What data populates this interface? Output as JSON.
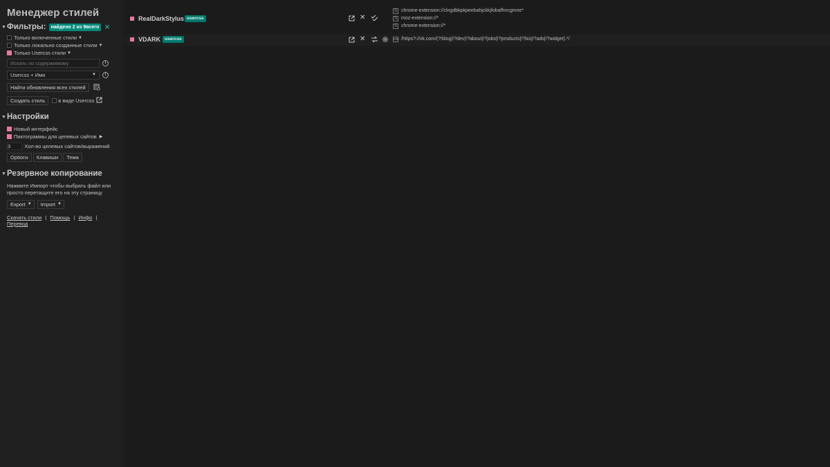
{
  "sidebar": {
    "title": "Менеджер стилей",
    "filters": {
      "heading": "Фильтры:",
      "found_badge": "найдено 2 из 9всего",
      "clear_icon": "close-icon",
      "options": [
        {
          "label": "Только включенные стили",
          "checked": false
        },
        {
          "label": "Только локально созданные стили",
          "checked": false
        },
        {
          "label": "Только Usercss стили",
          "checked": true
        }
      ],
      "search_placeholder": "Искать по содержимому",
      "sort_value": "Usercss + Имя",
      "find_updates_label": "Найти обновления всех стилей",
      "create_style_label": "Создать стиль",
      "as_usercss_label": "в виде Usercss"
    },
    "settings": {
      "heading": "Настройки",
      "options": [
        {
          "label": "Новый интерфейс",
          "checked": true
        },
        {
          "label": "Пиктограммы для целевых сайтов",
          "checked": true
        }
      ],
      "targets_count_value": "3",
      "targets_count_label": "Кол-во целевых сайтов/выражений",
      "buttons": [
        "Options",
        "Клавиши",
        "Тема"
      ]
    },
    "backup": {
      "heading": "Резервное копирование",
      "help_text": "Нажмите Импорт чтобы выбрать файл или просто перетащите его на эту страницу",
      "export_label": "Export",
      "import_label": "Import"
    },
    "links": {
      "get_styles": "Скачать стили",
      "help": "Помощь",
      "info": "Инфо",
      "translate": "Перевод",
      "separator": "|"
    }
  },
  "styles": [
    {
      "name": "RealDarkStylus",
      "badge": "usercss",
      "enabled": true,
      "targets": [
        {
          "icon": "S",
          "text": "chrome-extension://clngdbkpkpeebahjckkjfobafhncgmne*"
        },
        {
          "icon": "S",
          "text": "moz-extension://*"
        },
        {
          "icon": "S",
          "text": "chrome-extension://*"
        }
      ]
    },
    {
      "name": "VDARK",
      "badge": "usercss",
      "enabled": true,
      "targets": [
        {
          "icon": "css",
          "text": "/https?://vk.com/(?!blog|!?dev|!?about|!?jobs|!?products|!?bizj!?ads|!?widget).*/"
        }
      ]
    }
  ],
  "colors": {
    "accent": "#e67a9c",
    "badge": "#00796b",
    "background": "#1b1b1b",
    "sidebar": "#202020"
  }
}
